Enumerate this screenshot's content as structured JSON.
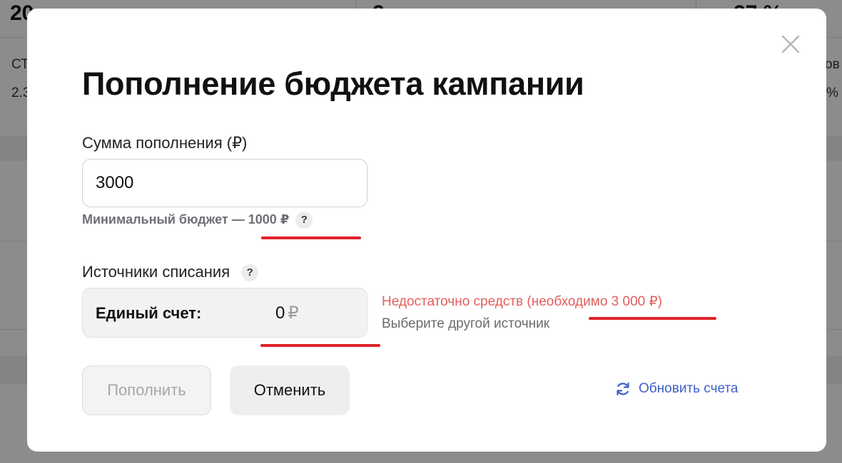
{
  "background": {
    "stats": [
      "20",
      "2",
      "27 %"
    ],
    "labels": [
      "СТ",
      "2.3",
      "ов",
      "%"
    ]
  },
  "modal": {
    "title": "Пополнение бюджета кампании",
    "amount": {
      "label": "Сумма пополнения (₽)",
      "value": "3000",
      "hint": "Минимальный бюджет — 1000 ₽",
      "help_glyph": "?"
    },
    "sources": {
      "label": "Источники списания",
      "help_glyph": "?",
      "account_name": "Единый счет:",
      "account_amount": "0",
      "account_currency": "₽",
      "error": "Недостаточно средств (необходимо 3 000 ₽)",
      "error_hint": "Выберите другой источник"
    },
    "buttons": {
      "submit": "Пополнить",
      "cancel": "Отменить",
      "refresh": "Обновить счета"
    }
  },
  "colors": {
    "error": "#e35d5d",
    "link": "#3d60c9",
    "underline": "#e0202a"
  }
}
